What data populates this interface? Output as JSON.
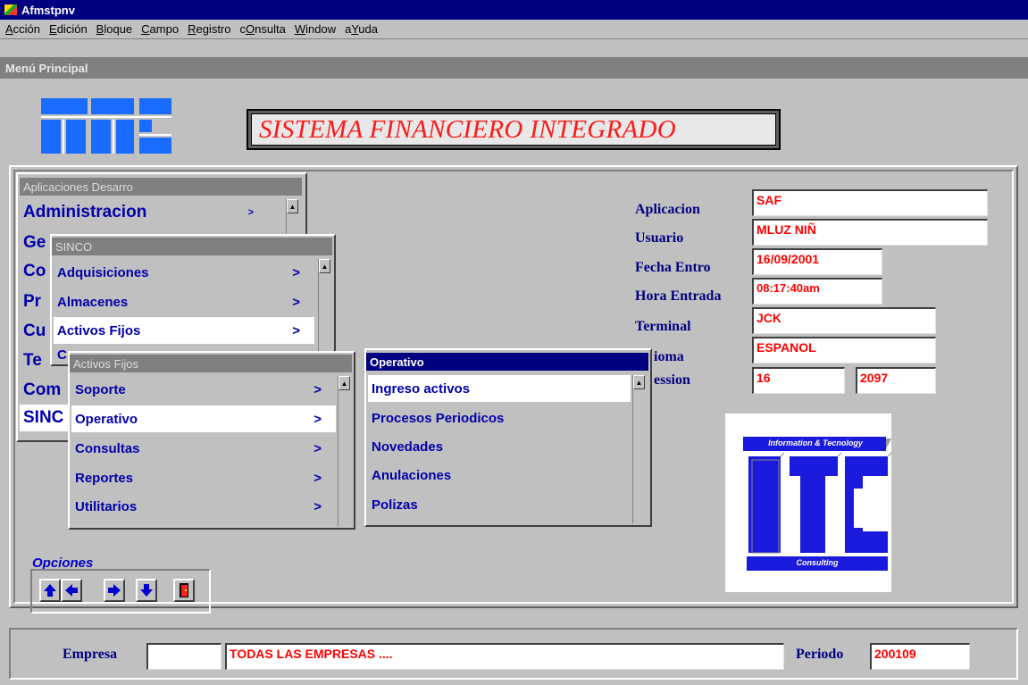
{
  "window": {
    "title": "Afmstpnv",
    "subtitle": "Menú Principal"
  },
  "menubar": [
    {
      "pre": "",
      "ul": "A",
      "post": "cción"
    },
    {
      "pre": "",
      "ul": "E",
      "post": "dición"
    },
    {
      "pre": "",
      "ul": "B",
      "post": "loque"
    },
    {
      "pre": "",
      "ul": "C",
      "post": "ampo"
    },
    {
      "pre": "",
      "ul": "R",
      "post": "egistro"
    },
    {
      "pre": "c",
      "ul": "O",
      "post": "nsulta"
    },
    {
      "pre": "",
      "ul": "W",
      "post": "indow"
    },
    {
      "pre": "a",
      "ul": "Y",
      "post": "uda"
    }
  ],
  "banner": {
    "title": "SISTEMA FINANCIERO INTEGRADO"
  },
  "app_menu": {
    "header": "Aplicaciones Desarro",
    "items": [
      "Administracion",
      "Ge",
      "Co",
      "Pr",
      "Cu",
      "Te",
      "Com",
      "SINC"
    ],
    "arrow": ">"
  },
  "sinco_menu": {
    "header": "SINCO",
    "items": [
      "Adquisiciones",
      "Almacenes",
      "Activos Fijos",
      "C"
    ],
    "arrow": ">"
  },
  "activos_menu": {
    "header": "Activos Fijos",
    "items": [
      "Soporte",
      "Operativo",
      "Consultas",
      "Reportes",
      "Utilitarios"
    ],
    "arrow": ">"
  },
  "operativo_menu": {
    "header": "Operativo",
    "items": [
      "Ingreso activos",
      "Procesos Periodicos",
      "Novedades",
      "Anulaciones",
      "Polizas"
    ]
  },
  "info": {
    "aplicacion_label": "Aplicacion",
    "aplicacion": "SAF",
    "usuario_label": "Usuario",
    "usuario": "MLUZ NIÑ",
    "fecha_label": "Fecha Entro",
    "fecha": "16/09/2001",
    "hora_label": "Hora Entrada",
    "hora": "08:17:40am",
    "terminal_label": "Terminal",
    "terminal": "JCK",
    "idioma_label": "ioma",
    "idioma": "ESPANOL",
    "session_label": "ession",
    "session_a": "16",
    "session_b": "2097"
  },
  "logo_text": {
    "top": "Information & Tecnology",
    "bottom": "Consulting"
  },
  "opciones": {
    "label": "Opciones"
  },
  "bottom": {
    "empresa_label": "Empresa",
    "empresa_code": "",
    "empresa_name": "TODAS LAS EMPRESAS ....",
    "periodo_label": "Periodo",
    "periodo": "200109"
  },
  "colors": {
    "title_bar": "#000080",
    "menu_text": "#0000aa",
    "field_text": "#ff0000",
    "background": "#c0c0c0"
  }
}
